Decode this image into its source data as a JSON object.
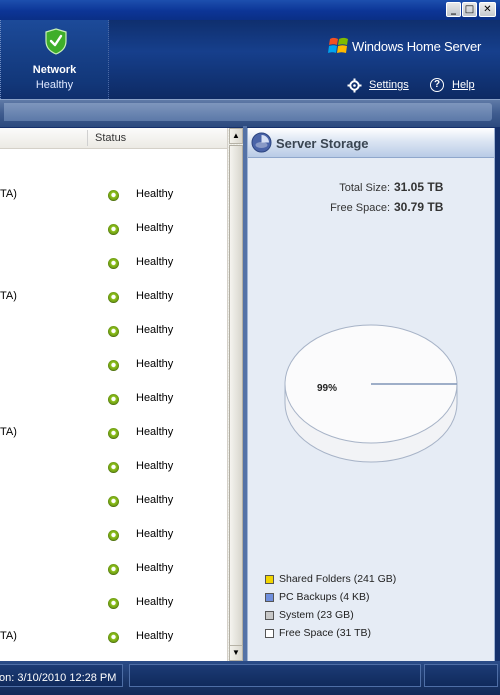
{
  "window": {
    "minimize_glyph": "_",
    "maximize_glyph": "□",
    "close_glyph": "✕"
  },
  "header": {
    "network_tab": {
      "title": "Network",
      "status": "Healthy",
      "icon": "shield-check-icon"
    },
    "product_name": "Windows Home Server",
    "links": {
      "settings": "Settings",
      "help": "Help"
    }
  },
  "list": {
    "column_status": "Status",
    "rows": [
      {
        "name_fragment": "TA)",
        "status": "Healthy"
      },
      {
        "name_fragment": "",
        "status": "Healthy"
      },
      {
        "name_fragment": "",
        "status": "Healthy"
      },
      {
        "name_fragment": "TA)",
        "status": "Healthy"
      },
      {
        "name_fragment": "",
        "status": "Healthy"
      },
      {
        "name_fragment": "",
        "status": "Healthy"
      },
      {
        "name_fragment": "",
        "status": "Healthy"
      },
      {
        "name_fragment": "TA)",
        "status": "Healthy"
      },
      {
        "name_fragment": "",
        "status": "Healthy"
      },
      {
        "name_fragment": "",
        "status": "Healthy"
      },
      {
        "name_fragment": "",
        "status": "Healthy"
      },
      {
        "name_fragment": "",
        "status": "Healthy"
      },
      {
        "name_fragment": "",
        "status": "Healthy"
      },
      {
        "name_fragment": "TA)",
        "status": "Healthy"
      }
    ]
  },
  "storage": {
    "title": "Server Storage",
    "total_label": "Total Size:",
    "total_value": "31.05 TB",
    "free_label": "Free Space:",
    "free_value": "30.79 TB",
    "pie_label": "99%",
    "legend": [
      {
        "label": "Shared Folders (241 GB)",
        "color": "#f2d500"
      },
      {
        "label": "PC Backups (4 KB)",
        "color": "#6f8fdd"
      },
      {
        "label": "System (23 GB)",
        "color": "#c8c8c8"
      },
      {
        "label": "Free Space (31 TB)",
        "color": "#ffffff"
      }
    ]
  },
  "statusbar": {
    "text": "on: 3/10/2010 12:28 PM"
  }
}
